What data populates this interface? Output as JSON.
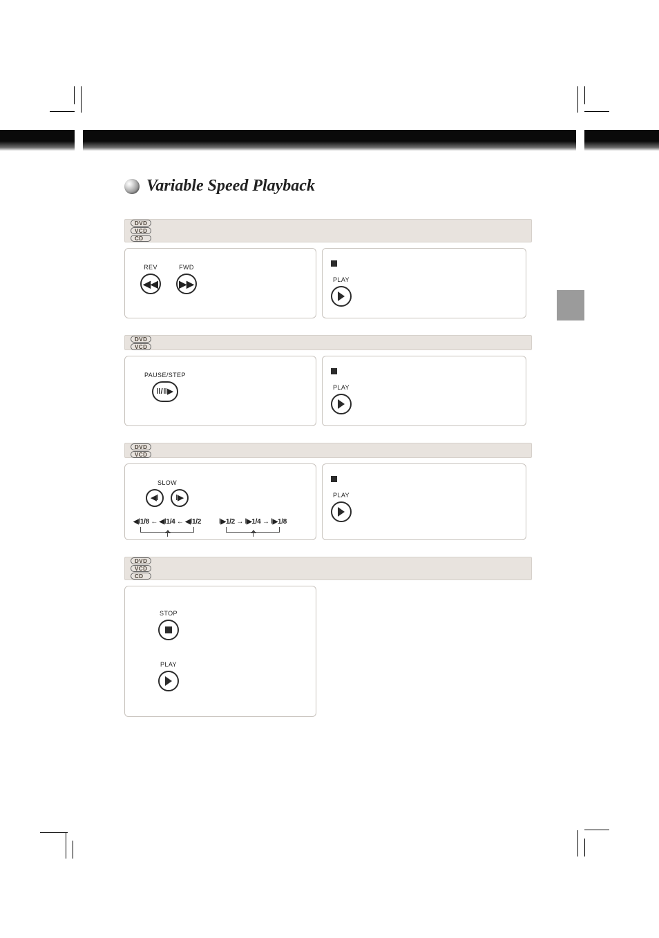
{
  "page": {
    "title": "Variable Speed Playback"
  },
  "badges": {
    "dvd": "DVD",
    "vcd": "VCD",
    "cd": "CD"
  },
  "buttons": {
    "rev": "REV",
    "fwd": "FWD",
    "play": "PLAY",
    "stop": "STOP",
    "pause_step": "PAUSE/STEP",
    "slow": "SLOW"
  },
  "slow_diagram": {
    "left": "◀ǀ1/8 ← ◀ǀ1/4 ← ◀ǀ1/2",
    "right": "ǀ▶1/2 → ǀ▶1/4 → ǀ▶1/8"
  }
}
